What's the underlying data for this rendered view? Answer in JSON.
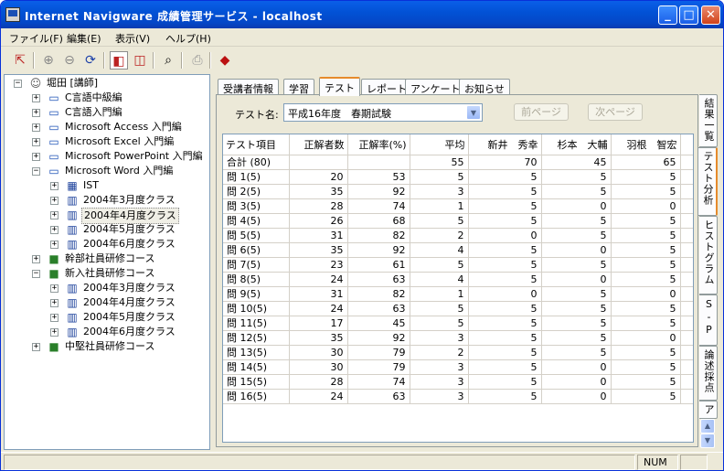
{
  "window": {
    "title": "Internet Navigware 成績管理サービス - localhost"
  },
  "menu": [
    "ファイル(F)",
    "編集(E)",
    "表示(V)",
    "ヘルプ(H)"
  ],
  "tree": {
    "root": "堀田 [講師]",
    "items": [
      {
        "label": "C言語中級編"
      },
      {
        "label": "C言語入門編"
      },
      {
        "label": "Microsoft Access 入門編"
      },
      {
        "label": "Microsoft Excel 入門編"
      },
      {
        "label": "Microsoft PowerPoint 入門編"
      },
      {
        "label": "Microsoft Word 入門編"
      },
      {
        "label": "IST"
      },
      {
        "label": "2004年3月度クラス"
      },
      {
        "label": "2004年4月度クラス"
      },
      {
        "label": "2004年5月度クラス"
      },
      {
        "label": "2004年6月度クラス"
      },
      {
        "label": "幹部社員研修コース"
      },
      {
        "label": "新入社員研修コース"
      },
      {
        "label": "2004年3月度クラス"
      },
      {
        "label": "2004年4月度クラス"
      },
      {
        "label": "2004年5月度クラス"
      },
      {
        "label": "2004年6月度クラス"
      },
      {
        "label": "中堅社員研修コース"
      }
    ]
  },
  "tabs": [
    "受講者情報",
    "学習",
    "テスト",
    "レポート",
    "アンケート",
    "お知らせ"
  ],
  "vtabs": [
    "結果一覧",
    "テスト分析",
    "ヒストグラム",
    "S-P表",
    "論述採点",
    "アン"
  ],
  "filter": {
    "label": "テスト名:",
    "value": "平成16年度　春期試験",
    "prev": "前ページ",
    "next": "次ページ"
  },
  "grid": {
    "headers": [
      "テスト項目",
      "正解者数",
      "正解率(%)",
      "平均",
      "新井　秀幸",
      "杉本　大輔",
      "羽根　智宏"
    ],
    "rows": [
      [
        "合計 (80)",
        "",
        "",
        "55",
        "70",
        "45",
        "65"
      ],
      [
        "問 1(5)",
        "20",
        "53",
        "5",
        "5",
        "5",
        "5"
      ],
      [
        "問 2(5)",
        "35",
        "92",
        "3",
        "5",
        "5",
        "5"
      ],
      [
        "問 3(5)",
        "28",
        "74",
        "1",
        "5",
        "0",
        "0"
      ],
      [
        "問 4(5)",
        "26",
        "68",
        "5",
        "5",
        "5",
        "5"
      ],
      [
        "問 5(5)",
        "31",
        "82",
        "2",
        "0",
        "5",
        "5"
      ],
      [
        "問 6(5)",
        "35",
        "92",
        "4",
        "5",
        "0",
        "5"
      ],
      [
        "問 7(5)",
        "23",
        "61",
        "5",
        "5",
        "5",
        "5"
      ],
      [
        "問 8(5)",
        "24",
        "63",
        "4",
        "5",
        "0",
        "5"
      ],
      [
        "問 9(5)",
        "31",
        "82",
        "1",
        "0",
        "5",
        "0"
      ],
      [
        "問 10(5)",
        "24",
        "63",
        "5",
        "5",
        "5",
        "5"
      ],
      [
        "問 11(5)",
        "17",
        "45",
        "5",
        "5",
        "5",
        "5"
      ],
      [
        "問 12(5)",
        "35",
        "92",
        "3",
        "5",
        "5",
        "0"
      ],
      [
        "問 13(5)",
        "30",
        "79",
        "2",
        "5",
        "5",
        "5"
      ],
      [
        "問 14(5)",
        "30",
        "79",
        "3",
        "5",
        "0",
        "5"
      ],
      [
        "問 15(5)",
        "28",
        "74",
        "3",
        "5",
        "0",
        "5"
      ],
      [
        "問 16(5)",
        "24",
        "63",
        "3",
        "5",
        "0",
        "5"
      ]
    ]
  },
  "status": {
    "num": "NUM"
  }
}
